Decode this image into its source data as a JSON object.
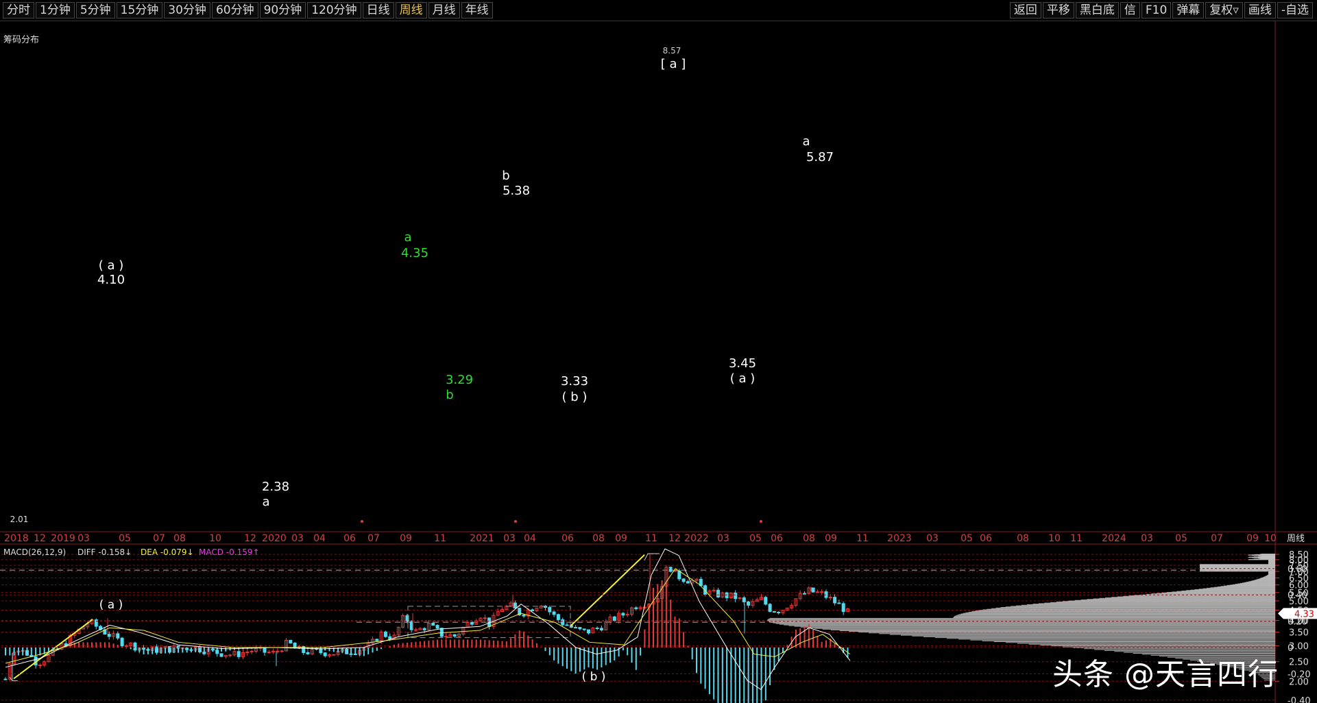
{
  "toolbar": {
    "left": [
      "分时",
      "1分钟",
      "5分钟",
      "15分钟",
      "30分钟",
      "60分钟",
      "90分钟",
      "120分钟",
      "日线",
      "周线",
      "月线",
      "年线"
    ],
    "active": "周线",
    "right": [
      "返回",
      "平移",
      "黑白底",
      "信",
      "F10",
      "弹幕",
      "复权▿",
      "画线",
      "-自选"
    ]
  },
  "chip_label": "筹码分布",
  "period_label": "周线",
  "current_price": "4.33",
  "price_ticks": [
    "8.50",
    "8.00",
    "7.50",
    "7.00",
    "6.50",
    "6.00",
    "5.50",
    "5.00",
    "4.50",
    "4.00",
    "3.50",
    "3.00",
    "2.50",
    "2.00"
  ],
  "date_ticks": [
    "2018",
    "12",
    "2019",
    "03",
    "05",
    "07",
    "08",
    "10",
    "12",
    "2020",
    "03",
    "04",
    "06",
    "07",
    "09",
    "11",
    "2021",
    "03",
    "04",
    "06",
    "08",
    "09",
    "11",
    "12",
    "2022",
    "03",
    "05",
    "06",
    "08",
    "09",
    "11",
    "2023",
    "03",
    "05",
    "06",
    "08",
    "10",
    "11",
    "2024",
    "03",
    "05",
    "07",
    "09",
    "10"
  ],
  "macd": {
    "title": "MACD(26,12,9)",
    "diff_label": "DIFF -0.158↓",
    "dea_label": "DEA -0.079↓",
    "macd_label": "MACD -0.159↑",
    "ticks": [
      "0.60",
      "0.40",
      "0.20",
      "0",
      "-0.20",
      "-0.40"
    ],
    "annotations": [
      "( a )",
      "( b )"
    ]
  },
  "annotations": {
    "low_2_01": "2.01",
    "a1_label": "( a )",
    "a1_value": "4.10",
    "a2_value": "2.38",
    "a2_label": "a",
    "g_a_label": "a",
    "g_a_value": "4.35",
    "g_b_value": "3.29",
    "g_b_label": "b",
    "b_label": "b",
    "b_value": "5.38",
    "bb_value": "3.33",
    "bb_label": "( b )",
    "peak_value": "8.57",
    "peak_label": "[ a ]",
    "aa_value": "3.45",
    "aa_label": "( a )",
    "a3_label": "a",
    "a3_value": "5.87"
  },
  "watermark": "头条 @天言四行",
  "colors": {
    "up": "#e23b3b",
    "down": "#54d8ee",
    "grid": "#7a1414",
    "yellow": "#f2f23a",
    "green": "#33dd33"
  },
  "chart_data": {
    "type": "candlestick",
    "title": "",
    "key_prices": [
      {
        "label": "2.01",
        "value": 2.01
      },
      {
        "label": "4.10",
        "value": 4.1
      },
      {
        "label": "2.38",
        "value": 2.38
      },
      {
        "label": "4.35",
        "value": 4.35
      },
      {
        "label": "3.29",
        "value": 3.29
      },
      {
        "label": "5.38",
        "value": 5.38
      },
      {
        "label": "3.33",
        "value": 3.33
      },
      {
        "label": "8.57",
        "value": 8.57
      },
      {
        "label": "3.45",
        "value": 3.45
      },
      {
        "label": "5.87",
        "value": 5.87
      }
    ],
    "ylim": [
      2.0,
      8.8
    ],
    "current": 4.33
  }
}
